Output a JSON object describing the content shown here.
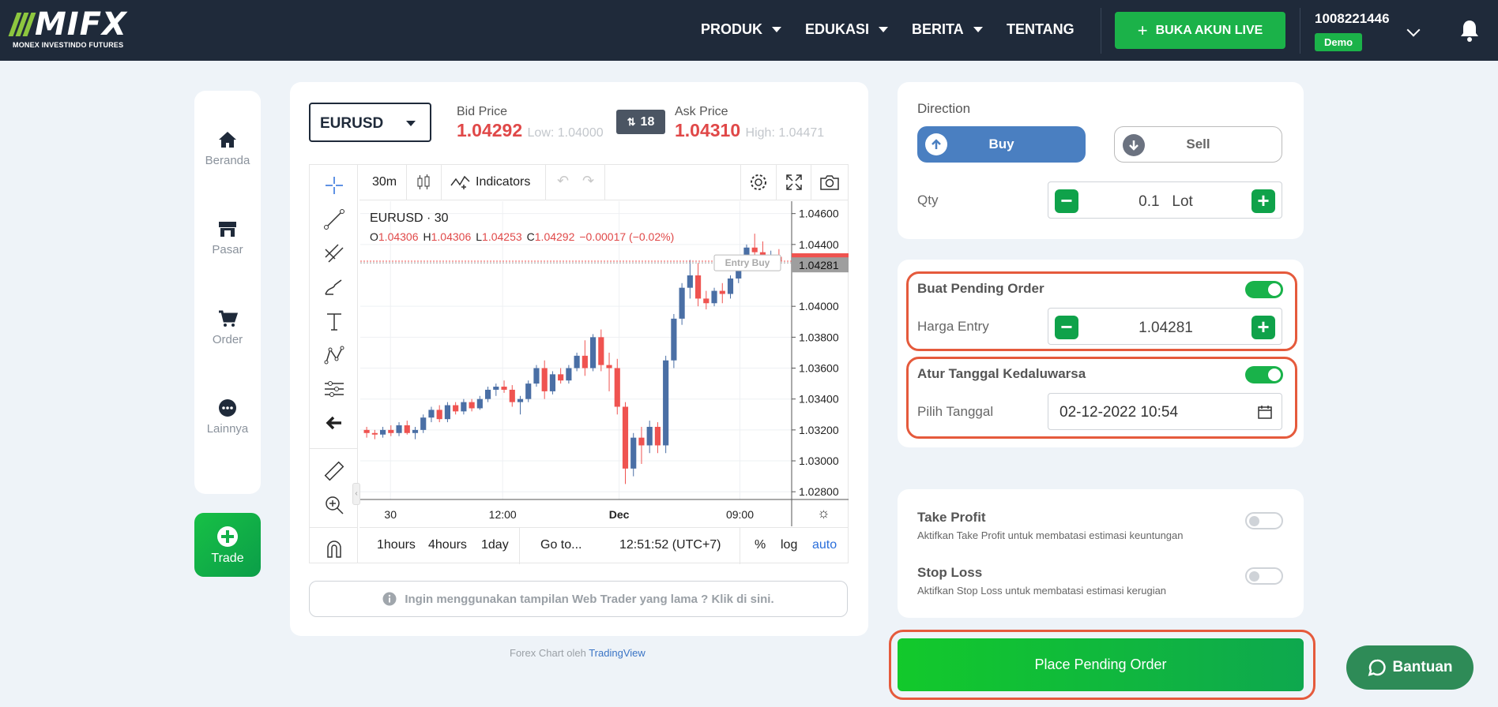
{
  "header": {
    "logo_text": "MIFX",
    "logo_sub": "MONEX INVESTINDO FUTURES",
    "nav": [
      {
        "label": "PRODUK",
        "dropdown": true
      },
      {
        "label": "EDUKASI",
        "dropdown": true
      },
      {
        "label": "BERITA",
        "dropdown": true
      },
      {
        "label": "TENTANG",
        "dropdown": false
      }
    ],
    "cta": "BUKA AKUN LIVE",
    "account_id": "1008221446",
    "account_type": "Demo"
  },
  "sidebar": {
    "items": [
      {
        "label": "Beranda",
        "icon": "home-icon"
      },
      {
        "label": "Pasar",
        "icon": "store-icon"
      },
      {
        "label": "Order",
        "icon": "cart-icon"
      },
      {
        "label": "Lainnya",
        "icon": "more-icon"
      }
    ],
    "trade_label": "Trade"
  },
  "quote": {
    "symbol": "EURUSD",
    "bid_label": "Bid Price",
    "bid": "1.04292",
    "low": "Low: 1.04000",
    "spread": "18",
    "ask_label": "Ask Price",
    "ask": "1.04310",
    "high": "High: 1.04471"
  },
  "chart_toolbar": {
    "interval": "30m",
    "indicators": "Indicators",
    "ranges": [
      "1hours",
      "4hours",
      "1day"
    ],
    "goto": "Go to...",
    "time": "12:51:52 (UTC+7)",
    "percent": "%",
    "log": "log",
    "auto": "auto"
  },
  "chart_data": {
    "type": "candlestick",
    "title": "EURUSD · 30",
    "ohlc_label": {
      "o": "1.04306",
      "h": "1.04306",
      "l": "1.04253",
      "c": "1.04292",
      "change": "−0.00017 (−0.02%)"
    },
    "y_ticks": [
      "1.04600",
      "1.04400",
      "1.04000",
      "1.03800",
      "1.03600",
      "1.03400",
      "1.03200",
      "1.03000",
      "1.02800"
    ],
    "ylim": [
      1.0275,
      1.0468
    ],
    "x_ticks": [
      "30",
      "12:00",
      "Dec",
      "09:00"
    ],
    "price_labels": {
      "bid": "1.04292",
      "entry": "1.04281"
    },
    "entry_label": "Entry Buy",
    "candles": [
      [
        1.032,
        1.0322,
        1.0315,
        1.0318
      ],
      [
        1.0318,
        1.032,
        1.0314,
        1.0317
      ],
      [
        1.0317,
        1.0322,
        1.0315,
        1.032
      ],
      [
        1.032,
        1.0323,
        1.0316,
        1.0318
      ],
      [
        1.0318,
        1.0325,
        1.0316,
        1.0323
      ],
      [
        1.0323,
        1.0326,
        1.0317,
        1.0318
      ],
      [
        1.0318,
        1.0322,
        1.0314,
        1.032
      ],
      [
        1.032,
        1.033,
        1.0318,
        1.0328
      ],
      [
        1.0328,
        1.0335,
        1.0325,
        1.0333
      ],
      [
        1.0333,
        1.0336,
        1.0325,
        1.0327
      ],
      [
        1.0327,
        1.0338,
        1.0325,
        1.0336
      ],
      [
        1.0336,
        1.0338,
        1.033,
        1.0332
      ],
      [
        1.0332,
        1.034,
        1.033,
        1.0338
      ],
      [
        1.0338,
        1.034,
        1.0332,
        1.0334
      ],
      [
        1.0334,
        1.0342,
        1.0333,
        1.034
      ],
      [
        1.034,
        1.0348,
        1.0338,
        1.0346
      ],
      [
        1.0346,
        1.035,
        1.0342,
        1.0348
      ],
      [
        1.0348,
        1.0352,
        1.0344,
        1.0346
      ],
      [
        1.0346,
        1.0349,
        1.0335,
        1.0338
      ],
      [
        1.0338,
        1.0342,
        1.033,
        1.034
      ],
      [
        1.034,
        1.0352,
        1.0338,
        1.035
      ],
      [
        1.035,
        1.0362,
        1.0348,
        1.036
      ],
      [
        1.036,
        1.0365,
        1.034,
        1.0345
      ],
      [
        1.0345,
        1.0358,
        1.0343,
        1.0356
      ],
      [
        1.0356,
        1.036,
        1.035,
        1.0352
      ],
      [
        1.0352,
        1.0362,
        1.035,
        1.036
      ],
      [
        1.036,
        1.037,
        1.0358,
        1.0368
      ],
      [
        1.0368,
        1.0378,
        1.0355,
        1.036
      ],
      [
        1.036,
        1.0382,
        1.0358,
        1.038
      ],
      [
        1.038,
        1.0385,
        1.0358,
        1.0362
      ],
      [
        1.0362,
        1.037,
        1.0345,
        1.036
      ],
      [
        1.036,
        1.0366,
        1.033,
        1.0335
      ],
      [
        1.0335,
        1.0338,
        1.0285,
        1.0295
      ],
      [
        1.0295,
        1.0318,
        1.029,
        1.0315
      ],
      [
        1.0315,
        1.0322,
        1.0298,
        1.031
      ],
      [
        1.031,
        1.0326,
        1.0305,
        1.0322
      ],
      [
        1.0322,
        1.0325,
        1.0305,
        1.031
      ],
      [
        1.031,
        1.0368,
        1.0305,
        1.0365
      ],
      [
        1.0365,
        1.0395,
        1.036,
        1.0392
      ],
      [
        1.0392,
        1.0415,
        1.0388,
        1.0412
      ],
      [
        1.0412,
        1.043,
        1.0405,
        1.042
      ],
      [
        1.042,
        1.0428,
        1.04,
        1.0405
      ],
      [
        1.0405,
        1.041,
        1.0398,
        1.0402
      ],
      [
        1.0402,
        1.0412,
        1.04,
        1.041
      ],
      [
        1.041,
        1.0415,
        1.0402,
        1.0408
      ],
      [
        1.0408,
        1.042,
        1.0405,
        1.0418
      ],
      [
        1.0418,
        1.043,
        1.0415,
        1.0428
      ],
      [
        1.0428,
        1.044,
        1.0425,
        1.0438
      ],
      [
        1.0438,
        1.0447,
        1.0432,
        1.0435
      ],
      [
        1.0435,
        1.0442,
        1.0426,
        1.043
      ],
      [
        1.043,
        1.0436,
        1.0425,
        1.0432
      ],
      [
        1.0432,
        1.0437,
        1.0426,
        1.0429
      ]
    ]
  },
  "legacy_banner": "Ingin menggunakan tampilan Web Trader yang lama ? Klik di sini.",
  "credit": {
    "prefix": "Forex Chart oleh",
    "link": "TradingView"
  },
  "order": {
    "direction_label": "Direction",
    "buy": "Buy",
    "sell": "Sell",
    "qty_label": "Qty",
    "qty": "0.1",
    "qty_unit": "Lot",
    "pending_label": "Buat Pending Order",
    "entry_label": "Harga Entry",
    "entry_value": "1.04281",
    "expiry_label": "Atur Tanggal Kedaluwarsa",
    "date_label": "Pilih Tanggal",
    "date_value": "02-12-2022 10:54",
    "tp_label": "Take Profit",
    "tp_desc": "Aktifkan Take Profit untuk membatasi estimasi keuntungan",
    "sl_label": "Stop Loss",
    "sl_desc": "Aktifkan Stop Loss untuk membatasi estimasi kerugian",
    "submit": "Place Pending Order"
  },
  "help": "Bantuan",
  "colors": {
    "accent_green": "#19b24a",
    "buy_blue": "#4a7fc1",
    "bid_red": "#e04848",
    "header": "#1f2a3a"
  }
}
